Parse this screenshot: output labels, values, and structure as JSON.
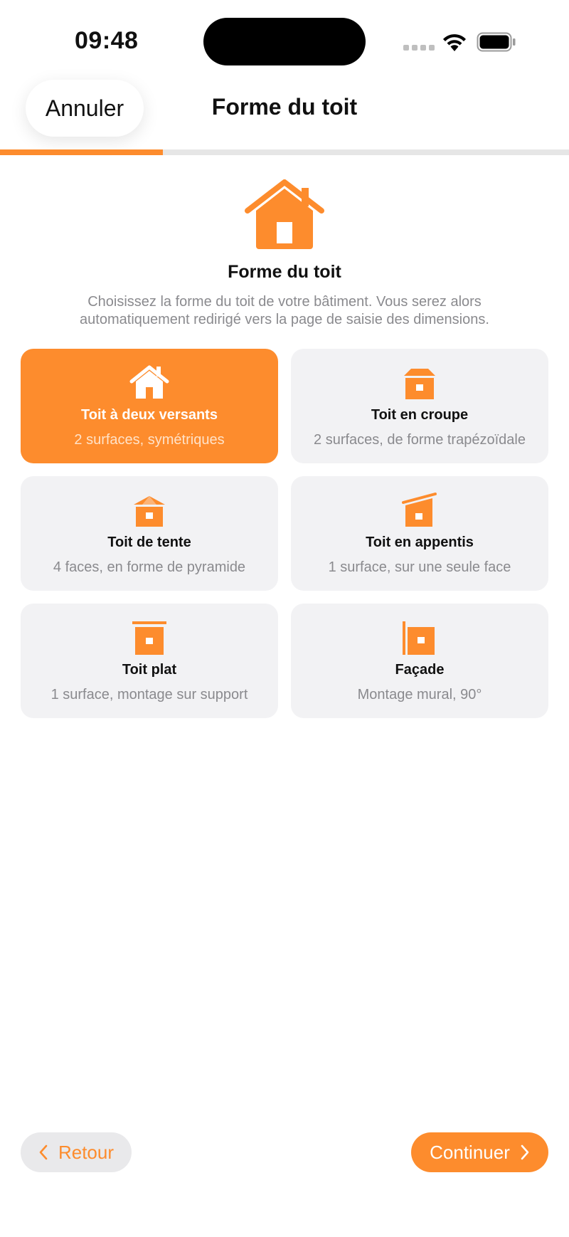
{
  "status_bar": {
    "time": "09:48"
  },
  "header": {
    "cancel_label": "Annuler",
    "title": "Forme du toit",
    "progress": 0.286
  },
  "hero": {
    "icon": "house-icon",
    "title": "Forme du toit",
    "description": "Choisissez la forme du toit de votre bâtiment. Vous serez alors automatiquement redirigé vers la page de saisie des dimensions."
  },
  "options": [
    {
      "icon": "gable-roof-icon",
      "title": "Toit à deux versants",
      "subtitle": "2 surfaces, symétriques",
      "selected": true
    },
    {
      "icon": "hip-roof-icon",
      "title": "Toit en croupe",
      "subtitle": "2 surfaces, de forme trapézoïdale",
      "selected": false
    },
    {
      "icon": "pyramid-roof-icon",
      "title": "Toit de tente",
      "subtitle": "4 faces, en forme de pyramide",
      "selected": false
    },
    {
      "icon": "shed-roof-icon",
      "title": "Toit en appentis",
      "subtitle": "1 surface, sur une seule face",
      "selected": false
    },
    {
      "icon": "flat-roof-icon",
      "title": "Toit plat",
      "subtitle": "1 surface, montage sur support",
      "selected": false
    },
    {
      "icon": "facade-icon",
      "title": "Façade",
      "subtitle": "Montage mural, 90°",
      "selected": false
    }
  ],
  "footer": {
    "back_label": "Retour",
    "continue_label": "Continuer"
  },
  "colors": {
    "accent": "#fd8c2d",
    "card_bg": "#f2f2f4",
    "secondary_text": "#8a8a8e"
  }
}
